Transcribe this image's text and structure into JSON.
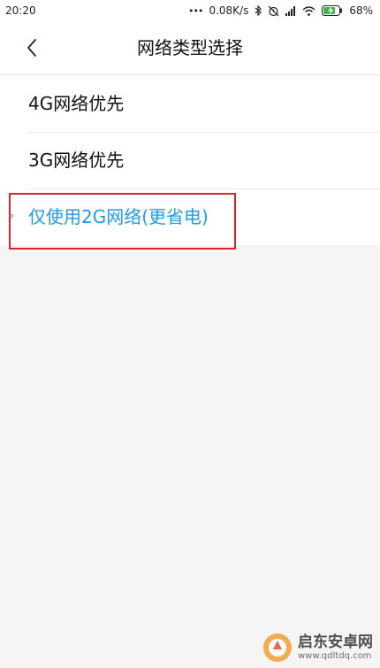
{
  "status_bar": {
    "time": "20:20",
    "dots": "•••",
    "speed": "0.08K/s",
    "battery": "68%"
  },
  "header": {
    "title": "网络类型选择"
  },
  "network_options": [
    {
      "label": "4G网络优先",
      "selected": false
    },
    {
      "label": "3G网络优先",
      "selected": false
    },
    {
      "label": "仅使用2G网络(更省电)",
      "selected": true
    }
  ],
  "check_glyph": "›",
  "watermark": {
    "title": "启东安卓网",
    "url": "www.qdltdq.com"
  },
  "colors": {
    "accent": "#1e9bef",
    "highlight": "#d8262b",
    "background": "#f5f5f5"
  }
}
